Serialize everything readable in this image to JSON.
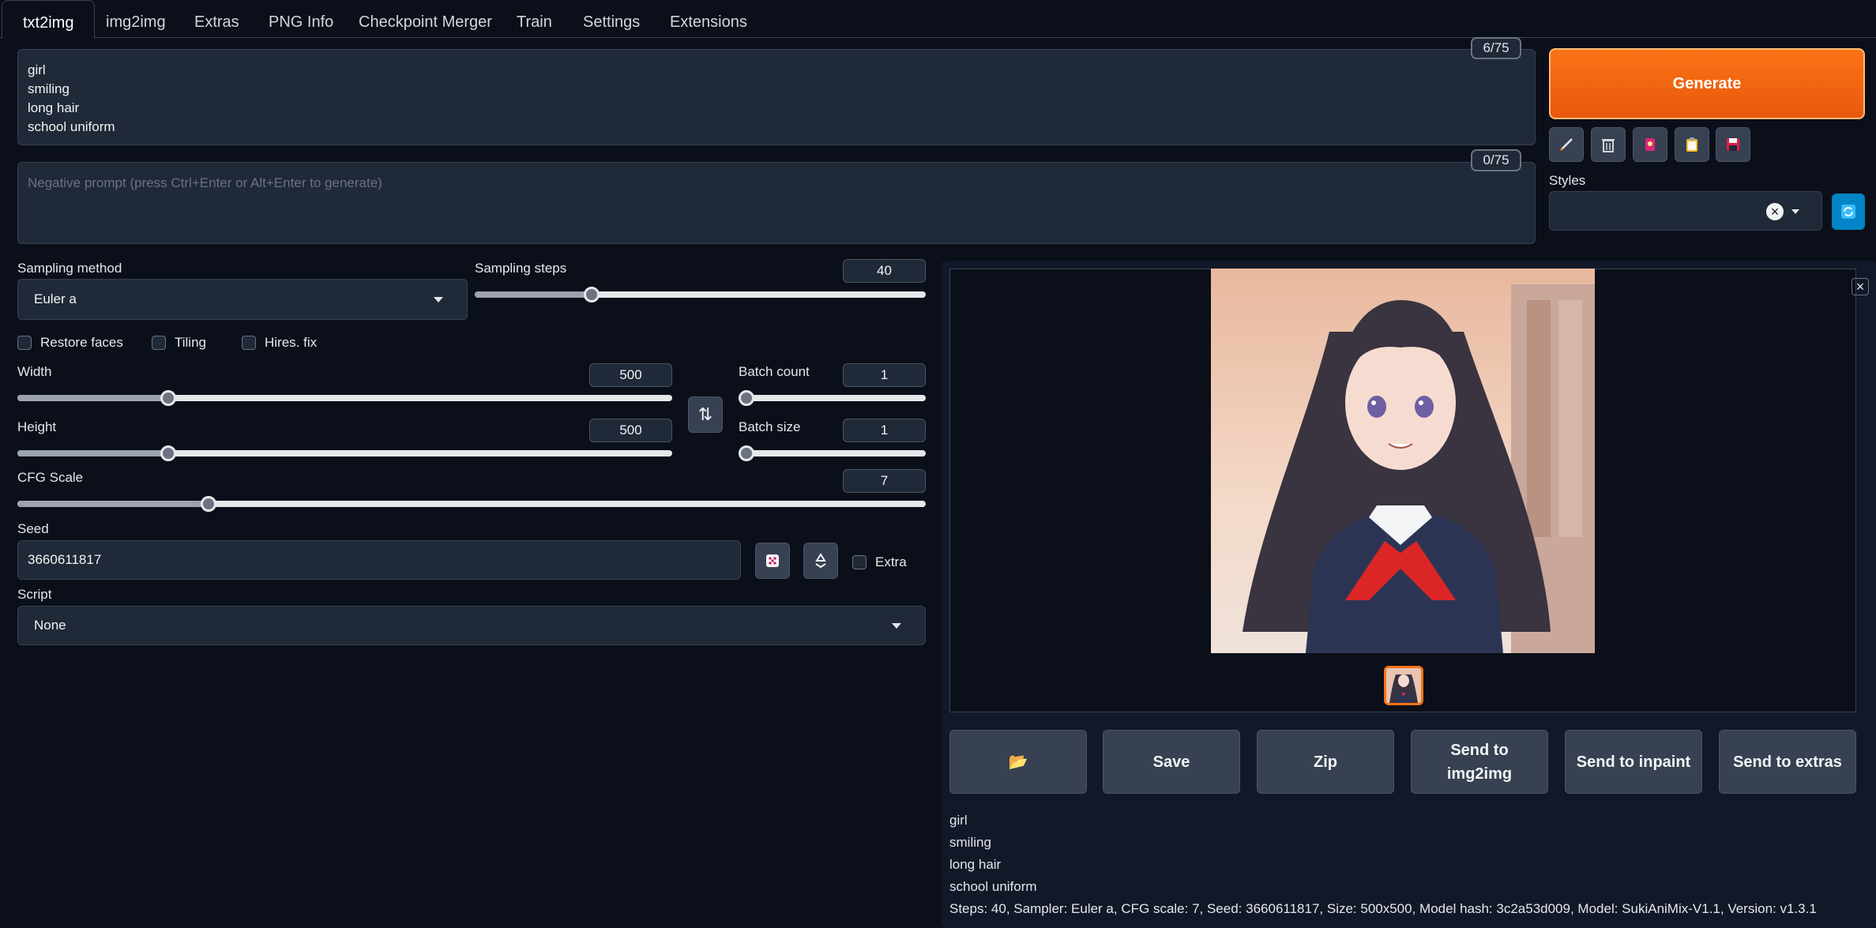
{
  "tabs": [
    "txt2img",
    "img2img",
    "Extras",
    "PNG Info",
    "Checkpoint Merger",
    "Train",
    "Settings",
    "Extensions"
  ],
  "prompt": {
    "text": "girl\nsmiling\nlong hair\nschool uniform",
    "counter": "6/75"
  },
  "negative_prompt": {
    "placeholder": "Negative prompt (press Ctrl+Enter or Alt+Enter to generate)",
    "counter": "0/75"
  },
  "generate_label": "Generate",
  "toolbar_icons": [
    "pencil-icon",
    "trash-icon",
    "red-card-icon",
    "clipboard-icon",
    "floppy-disk-icon"
  ],
  "styles": {
    "label": "Styles",
    "clear_glyph": "×"
  },
  "sampling_method": {
    "label": "Sampling method",
    "value": "Euler a"
  },
  "sampling_steps": {
    "label": "Sampling steps",
    "value": "40",
    "fraction": 0.26
  },
  "checkboxes": {
    "restore_faces": "Restore faces",
    "tiling": "Tiling",
    "hires_fix": "Hires. fix"
  },
  "width": {
    "label": "Width",
    "value": "500",
    "fraction": 0.23
  },
  "height": {
    "label": "Height",
    "value": "500",
    "fraction": 0.23
  },
  "swap_glyph": "⇅",
  "batch_count": {
    "label": "Batch count",
    "value": "1",
    "fraction": 0
  },
  "batch_size": {
    "label": "Batch size",
    "value": "1",
    "fraction": 0
  },
  "cfg_scale": {
    "label": "CFG Scale",
    "value": "7",
    "fraction": 0.21
  },
  "seed": {
    "label": "Seed",
    "value": "3660611817",
    "extra_label": "Extra"
  },
  "script": {
    "label": "Script",
    "value": "None"
  },
  "output_buttons": {
    "folder_glyph": "📂",
    "save": "Save",
    "zip": "Zip",
    "send_img2img": "Send to img2img",
    "send_inpaint": "Send to inpaint",
    "send_extras": "Send to extras"
  },
  "close_glyph": "×",
  "output_info": {
    "lines": [
      "girl",
      "smiling",
      "long hair",
      "school uniform"
    ],
    "params": "Steps: 40, Sampler: Euler a, CFG scale: 7, Seed: 3660611817, Size: 500x500, Model hash: 3c2a53d009, Model: SukiAniMix-V1.1, Version: v1.3.1"
  },
  "colors": {
    "accent": "#f97316",
    "background": "#0b0f19",
    "panel": "#1f2937"
  }
}
